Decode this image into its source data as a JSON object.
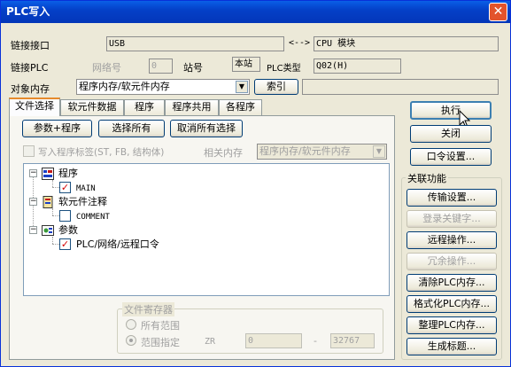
{
  "window": {
    "title": "PLC写入",
    "close_symbol": "✕"
  },
  "connection": {
    "link_interface_label": "链接接口",
    "link_interface_value": "USB",
    "arrow": "<-->",
    "cpu_value": "CPU 模块",
    "link_plc_label": "链接PLC",
    "network_no_label": "网络号",
    "network_no_value": "0",
    "station_no_label": "站号",
    "station_no_value": "本站",
    "plc_type_label": "PLC类型",
    "plc_type_value": "Q02(H)",
    "target_memory_label": "对象内存",
    "target_memory_value": "程序内存/软元件内存",
    "index_button": "索引",
    "index_value": ""
  },
  "tabs": [
    {
      "label": "文件选择"
    },
    {
      "label": "软元件数据"
    },
    {
      "label": "程序"
    },
    {
      "label": "程序共用"
    },
    {
      "label": "各程序"
    }
  ],
  "file_select": {
    "param_program_button": "参数+程序",
    "select_all_button": "选择所有",
    "deselect_all_button": "取消所有选择",
    "write_labels_checkbox": "写入程序标签(ST, FB, 结构体)",
    "related_memory_label": "相关内存",
    "related_memory_value": "程序内存/软元件内存"
  },
  "tree": {
    "program_label": "程序",
    "main_label": "MAIN",
    "device_comment_label": "软元件注释",
    "comment_label": "COMMENT",
    "param_label": "参数",
    "plc_network_label": "PLC/网络/远程口令"
  },
  "file_register": {
    "group_title": "文件寄存器",
    "all_range": "所有范围",
    "range_specify": "范围指定",
    "zr_label": "ZR",
    "from_value": "0",
    "dash": "-",
    "to_value": "32767"
  },
  "right_panel": {
    "execute_button": "执行",
    "close_button": "关闭",
    "password_button": "口令设置...",
    "related_group_title": "关联功能",
    "transfer_setup": "传输设置...",
    "login_keyword": "登录关键字...",
    "remote_operation": "远程操作...",
    "redundant_operation": "冗余操作...",
    "clear_plc_memory": "清除PLC内存...",
    "format_plc_memory": "格式化PLC内存...",
    "organize_plc_memory": "整理PLC内存...",
    "generate_title": "生成标题..."
  }
}
